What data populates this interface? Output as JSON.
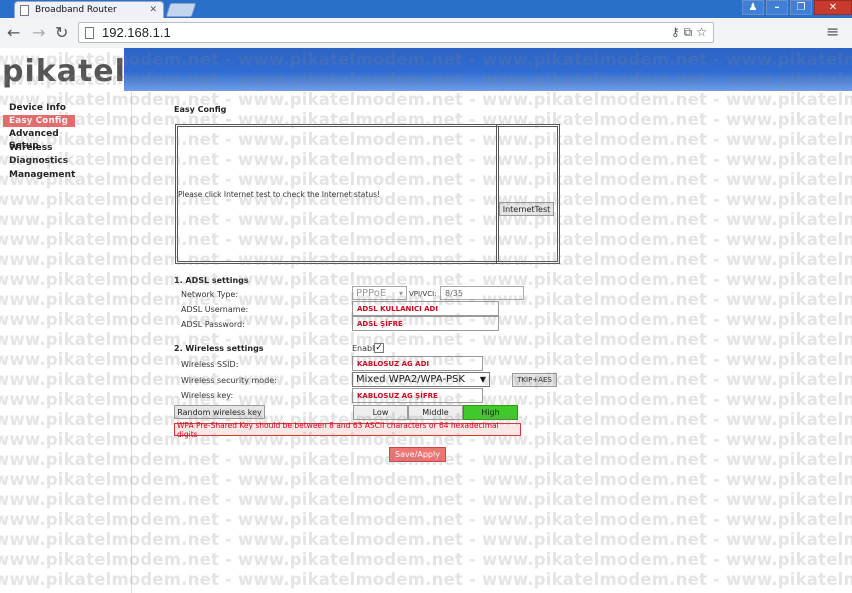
{
  "browser": {
    "tab_title": "Broadband Router",
    "tab_close": "✕",
    "url": "192.168.1.1"
  },
  "header": {
    "logo": "pikatel"
  },
  "sidebar": {
    "items": [
      {
        "label": "Device Info",
        "active": false
      },
      {
        "label": "Easy Config",
        "active": true
      },
      {
        "label": "Advanced Setup",
        "active": false
      },
      {
        "label": "Wireless",
        "active": false
      },
      {
        "label": "Diagnostics",
        "active": false
      },
      {
        "label": "Management",
        "active": false
      }
    ]
  },
  "main": {
    "page_title": "Easy Config",
    "status_message": "Please click Internet test to check the Internet status!",
    "internet_test_button": "InternetTest",
    "adsl": {
      "heading": "1. ADSL settings",
      "network_type_label": "Network Type:",
      "network_type_value": "PPPoE",
      "vpi_vci_label": "VPI/VCI:",
      "vpi_vci_value": "8/35",
      "username_label": "ADSL Username:",
      "username_value": "ADSL KULLANICI ADI",
      "password_label": "ADSL Password:",
      "password_value": "ADSL ŞİFRE"
    },
    "wireless": {
      "heading": "2. Wireless settings",
      "enable_label": "Enable",
      "enable_checked": true,
      "ssid_label": "Wireless SSID:",
      "ssid_value": "KABLOSUZ AG ADI",
      "security_label": "Wireless security mode:",
      "security_value": "Mixed WPA2/WPA-PSK",
      "cipher_button": "TKIP+AES",
      "key_label": "Wireless key:",
      "key_value": "KABLOSUZ AG ŞİFRE",
      "random_key_button": "Random wireless key",
      "strength_levels": [
        "Low",
        "Middle",
        "High"
      ],
      "selected_level": "High",
      "warning": "WPA Pre-Shared Key should be between 8 and 63 ASCII characters or 64 hexadecimal digits"
    },
    "save_button": "Save/Apply"
  },
  "watermark": {
    "text": "www.pikatelmodem.net - www.pikatelmodem.net - www.pikatelmodem.net - www.pikatelmodem.net - www.pikatelmodem.net -"
  },
  "colors": {
    "banner": "#2f6cd2",
    "active_nav": "#ee6a6a",
    "level_high": "#41c92a",
    "warning_text": "#d4001a"
  },
  "icons": {
    "back": "back-arrow-icon",
    "forward": "forward-arrow-icon",
    "reload": "reload-icon",
    "menu": "hamburger-menu-icon"
  }
}
